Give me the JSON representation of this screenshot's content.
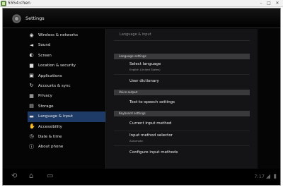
{
  "window": {
    "title": "5554:chen",
    "minimize_glyph": "–",
    "maximize_glyph": "□",
    "close_glyph": "✕"
  },
  "header": {
    "title": "Settings",
    "icon": "settings-gear-icon"
  },
  "sidebar": {
    "items": [
      {
        "label": "Wireless & networks",
        "icon": "wifi-icon",
        "glyph": "◉",
        "active": false
      },
      {
        "label": "Sound",
        "icon": "speaker-icon",
        "glyph": "◄",
        "active": false
      },
      {
        "label": "Screen",
        "icon": "brightness-icon",
        "glyph": "◐",
        "active": false
      },
      {
        "label": "Location & security",
        "icon": "lock-icon",
        "glyph": "■",
        "active": false
      },
      {
        "label": "Applications",
        "icon": "apps-icon",
        "glyph": "▣",
        "active": false
      },
      {
        "label": "Accounts & sync",
        "icon": "sync-icon",
        "glyph": "↻",
        "active": false
      },
      {
        "label": "Privacy",
        "icon": "privacy-icon",
        "glyph": "▦",
        "active": false
      },
      {
        "label": "Storage",
        "icon": "storage-icon",
        "glyph": "▤",
        "active": false
      },
      {
        "label": "Language & input",
        "icon": "keyboard-icon",
        "glyph": "▬",
        "active": true
      },
      {
        "label": "Accessibility",
        "icon": "accessibility-icon",
        "glyph": "✋",
        "active": false
      },
      {
        "label": "Date & time",
        "icon": "clock-icon",
        "glyph": "◷",
        "active": false
      },
      {
        "label": "About phone",
        "icon": "info-icon",
        "glyph": "ⓘ",
        "active": false
      }
    ]
  },
  "main": {
    "title": "Language & input",
    "sections": {
      "language": "Language settings",
      "voice": "Voice output",
      "keyboard": "Keyboard settings"
    },
    "rows": {
      "select_language": {
        "title": "Select language",
        "summary": "English (United States)"
      },
      "user_dictionary": {
        "title": "User dictionary"
      },
      "tts": {
        "title": "Text-to-speech settings"
      },
      "current_input": {
        "title": "Current input method"
      },
      "input_selector": {
        "title": "Input method selector",
        "summary": "Automatic"
      },
      "configure": {
        "title": "Configure input methods"
      }
    }
  },
  "system_bar": {
    "back_icon": "back-icon",
    "home_icon": "home-icon",
    "recents_icon": "recent-apps-icon",
    "back_glyph": "⟲",
    "home_glyph": "⌂",
    "recents_glyph": "▭",
    "clock": "7:17",
    "signal_glyph": "◢",
    "battery_glyph": "▮"
  },
  "colors": {
    "accent_active": "#1e3a66",
    "section_header": "#3a3a3c",
    "background": "#050505"
  }
}
